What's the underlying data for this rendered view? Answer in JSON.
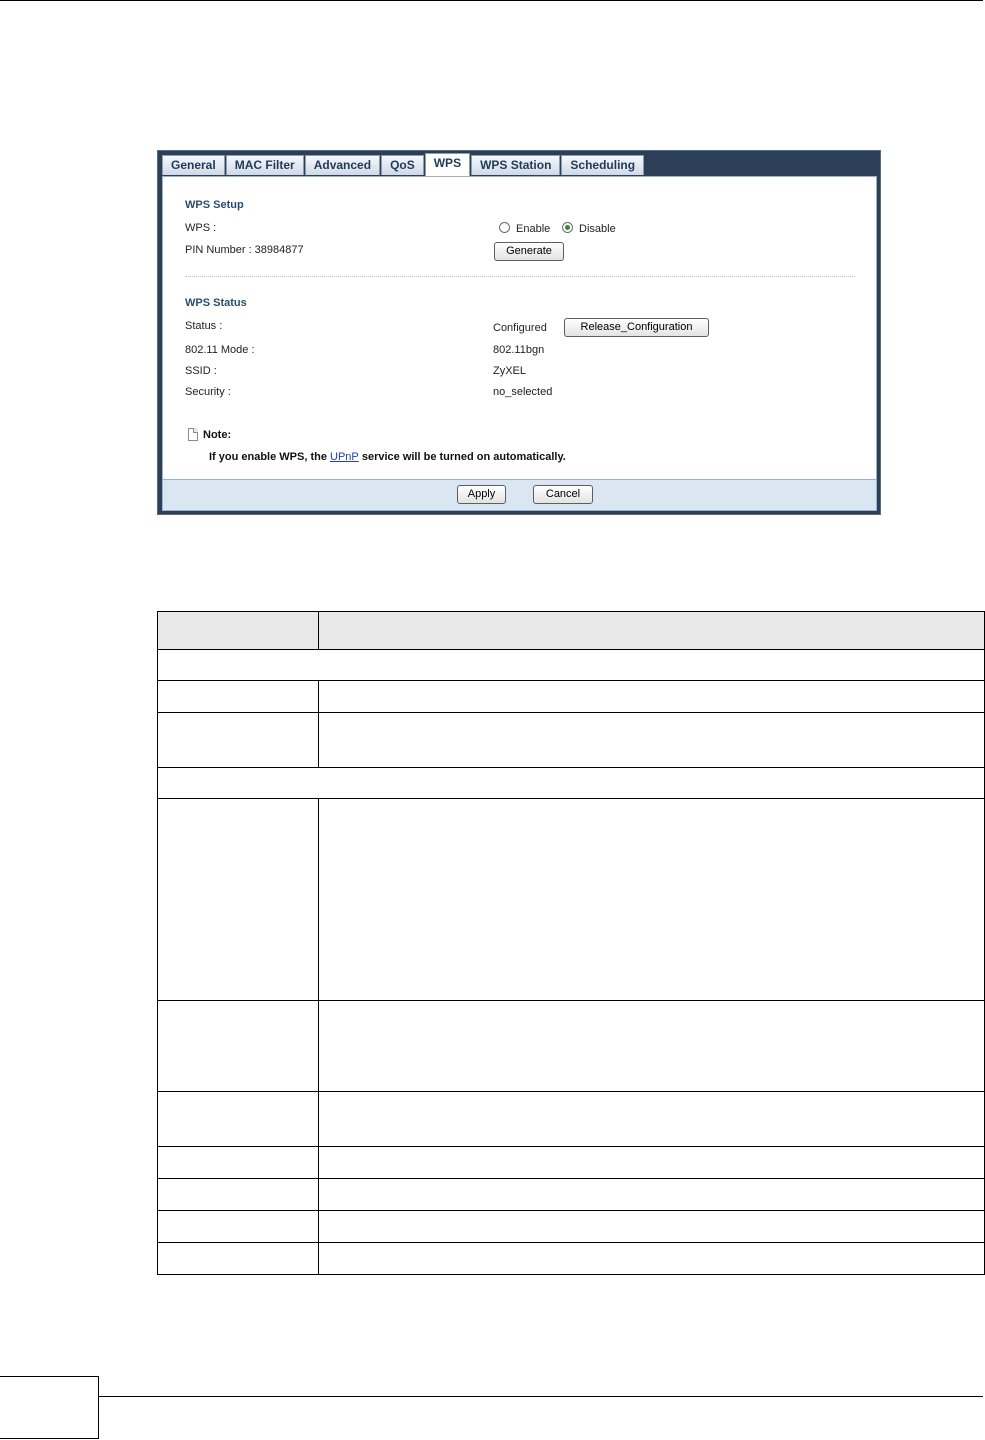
{
  "tabs": [
    {
      "label": "General",
      "active": false
    },
    {
      "label": "MAC Filter",
      "active": false
    },
    {
      "label": "Advanced",
      "active": false
    },
    {
      "label": "QoS",
      "active": false
    },
    {
      "label": "WPS",
      "active": true
    },
    {
      "label": "WPS Station",
      "active": false
    },
    {
      "label": "Scheduling",
      "active": false
    }
  ],
  "wps_setup": {
    "title": "WPS Setup",
    "wps_label": "WPS :",
    "enable_label": "Enable",
    "disable_label": "Disable",
    "selected": "Disable",
    "pin_label": "PIN Number : 38984877",
    "generate_button": "Generate"
  },
  "wps_status": {
    "title": "WPS Status",
    "status_label": "Status :",
    "status_value": "Configured",
    "release_button": "Release_Configuration",
    "mode_label": "802.11 Mode :",
    "mode_value": "802.11bgn",
    "ssid_label": "SSID :",
    "ssid_value": "ZyXEL",
    "security_label": "Security :",
    "security_value": "no_selected"
  },
  "note": {
    "title": "Note:",
    "text_before": "If you enable WPS, the ",
    "link": "UPnP",
    "text_after": " service will be turned on automatically."
  },
  "footer": {
    "apply_button": "Apply",
    "cancel_button": "Cancel"
  }
}
